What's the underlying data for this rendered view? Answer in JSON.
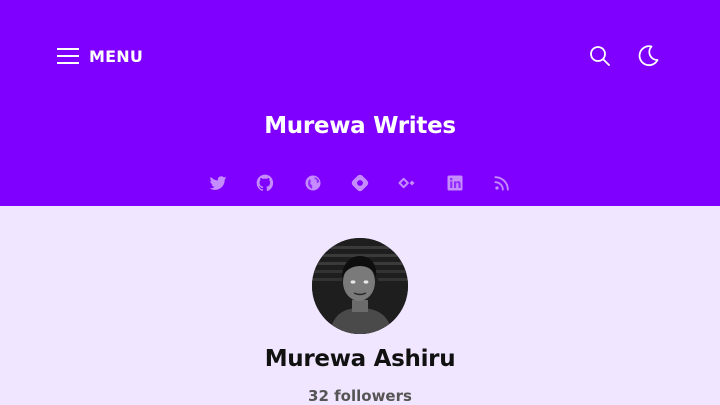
{
  "header": {
    "background": "#8000ff",
    "menu_label": "MENU",
    "site_title": "Murewa Writes",
    "icons": {
      "menu": "hamburger-icon",
      "search": "search-icon",
      "theme": "moon-icon"
    },
    "socials": [
      {
        "icon": "twitter-icon"
      },
      {
        "icon": "github-icon"
      },
      {
        "icon": "globe-icon"
      },
      {
        "icon": "hashnode-icon"
      },
      {
        "icon": "polywork-icon"
      },
      {
        "icon": "linkedin-icon"
      },
      {
        "icon": "rss-icon"
      }
    ]
  },
  "profile": {
    "background": "#f1e6ff",
    "name": "Murewa Ashiru",
    "followers_count": "32",
    "followers_label": "followers"
  }
}
